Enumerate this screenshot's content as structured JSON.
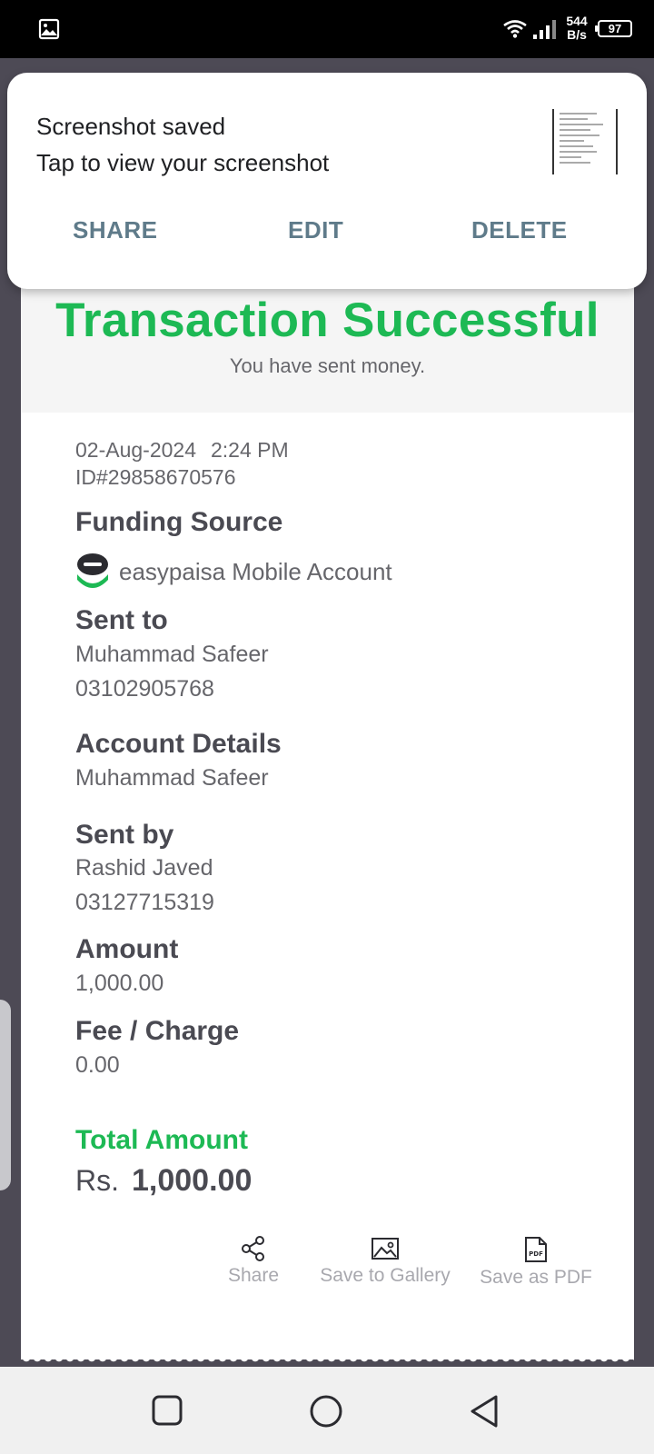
{
  "status_bar": {
    "net_speed_value": "544",
    "net_speed_unit": "B/s",
    "battery": "97"
  },
  "notification": {
    "title": "Screenshot saved",
    "text": "Tap to view your screenshot",
    "actions": {
      "share": "SHARE",
      "edit": "EDIT",
      "delete": "DELETE"
    }
  },
  "receipt": {
    "title": "Transaction Successful",
    "subtitle": "You have sent money.",
    "date": "02-Aug-2024",
    "time": "2:24 PM",
    "transaction_id": "ID#29858670576",
    "funding_source": {
      "label": "Funding Source",
      "value": "easypaisa Mobile Account"
    },
    "sent_to": {
      "label": "Sent to",
      "name": "Muhammad Safeer",
      "number": "03102905768"
    },
    "account_details": {
      "label": "Account Details",
      "name": "Muhammad Safeer"
    },
    "sent_by": {
      "label": "Sent by",
      "name": "Rashid Javed",
      "number": "03127715319"
    },
    "amount": {
      "label": "Amount",
      "value": "1,000.00"
    },
    "fee": {
      "label": "Fee / Charge",
      "value": "0.00"
    },
    "total": {
      "label": "Total Amount",
      "currency": "Rs.",
      "value": "1,000.00"
    },
    "actions": {
      "share": "Share",
      "gallery": "Save to Gallery",
      "pdf": "Save as PDF"
    }
  },
  "colors": {
    "success_green": "#1db954",
    "notification_action": "#5f7b8a",
    "backdrop": "#4d4a55"
  }
}
